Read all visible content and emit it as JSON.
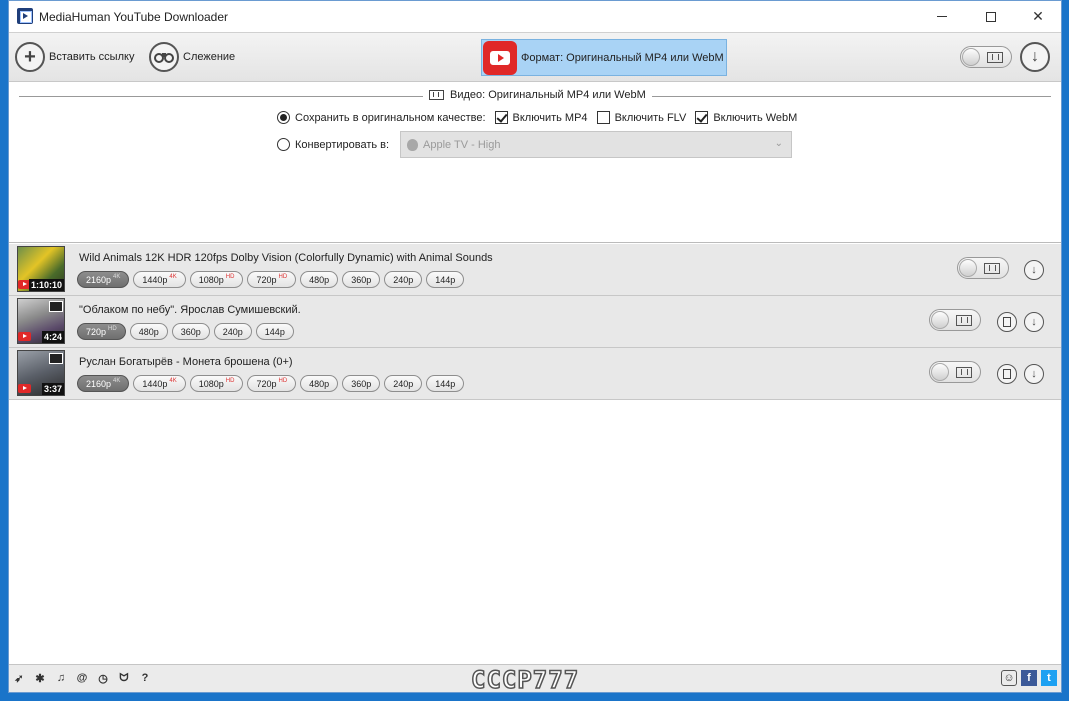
{
  "window": {
    "title": "MediaHuman YouTube Downloader"
  },
  "toolbar": {
    "paste_label": "Вставить ссылку",
    "tracking_label": "Слежение",
    "format_label": "Формат: Оригинальный MP4 или WebM"
  },
  "settings": {
    "section_title": "Видео: Оригинальный MP4 или WebM",
    "option_original": "Сохранить в оригинальном качестве:",
    "include_mp4": "Включить MP4",
    "include_flv": "Включить FLV",
    "include_webm": "Включить WebM",
    "option_convert": "Конвертировать в:",
    "convert_preset": "Apple TV - High",
    "original_selected": true,
    "mp4_checked": true,
    "flv_checked": false,
    "webm_checked": true
  },
  "videos": [
    {
      "title": "Wild Animals 12K HDR 120fps Dolby Vision (Colorfully Dynamic) with Animal Sounds",
      "duration": "1:10:10",
      "qualities": [
        {
          "label": "2160p",
          "badge": "4K"
        },
        {
          "label": "1440p",
          "badge": "4K"
        },
        {
          "label": "1080p",
          "badge": "HD"
        },
        {
          "label": "720p",
          "badge": "HD"
        },
        {
          "label": "480p",
          "badge": ""
        },
        {
          "label": "360p",
          "badge": ""
        },
        {
          "label": "240p",
          "badge": ""
        },
        {
          "label": "144p",
          "badge": ""
        }
      ]
    },
    {
      "title": "\"Облаком по небу\". Ярослав Сумишевский.",
      "duration": "4:24",
      "qualities": [
        {
          "label": "720p",
          "badge": "HD"
        },
        {
          "label": "480p",
          "badge": ""
        },
        {
          "label": "360p",
          "badge": ""
        },
        {
          "label": "240p",
          "badge": ""
        },
        {
          "label": "144p",
          "badge": ""
        }
      ]
    },
    {
      "title": "Руслан Богатырёв - Монета брошена (0+)",
      "duration": "3:37",
      "qualities": [
        {
          "label": "2160p",
          "badge": "4K"
        },
        {
          "label": "1440p",
          "badge": "4K"
        },
        {
          "label": "1080p",
          "badge": "HD"
        },
        {
          "label": "720p",
          "badge": "HD"
        },
        {
          "label": "480p",
          "badge": ""
        },
        {
          "label": "360p",
          "badge": ""
        },
        {
          "label": "240p",
          "badge": ""
        },
        {
          "label": "144p",
          "badge": ""
        }
      ]
    }
  ],
  "statusbar": {
    "help_label": "?",
    "watermark": "CCCP777"
  },
  "colors": {
    "format_button_bg": "#a9d3f5",
    "youtube_red": "#e02828",
    "facebook": "#3b5998",
    "twitter": "#1da1f2"
  }
}
